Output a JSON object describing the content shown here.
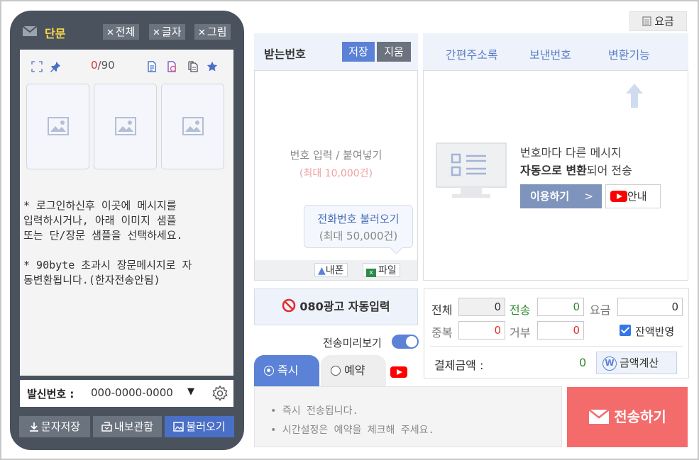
{
  "phone": {
    "msg_type": "단문",
    "clear_buttons": [
      "전체",
      "글자",
      "그림"
    ],
    "byte_current": "0",
    "byte_max": "/90",
    "message_lines": [
      "* 로그인하신후 이곳에 메시지를\n입력하시거나, 아래 이미지 샘플\n또는 단/장문 샘플을 선택하세요.",
      "* 90byte 초과시 장문메시지로 자\n동변환됩니다.(한자전송안됨)"
    ],
    "sender_label": "발신번호 :",
    "sender_number": "000-0000-0000",
    "buttons": {
      "save": "문자저장",
      "sent_box": "내보관함",
      "load": "불러오기"
    }
  },
  "receiver": {
    "title": "받는번호",
    "save_btn": "저장",
    "clear_btn": "지움",
    "hint": "번호 입력 / 붙여넣기",
    "hint_max": "(최대 10,000건)",
    "bubble_title": "전화번호 불러오기",
    "bubble_max": "(최대 50,000건)",
    "my_phone": "내폰",
    "file": "파일"
  },
  "top_right": {
    "fee": "요금"
  },
  "tabs": [
    "간편주소록",
    "보낸번호",
    "변환기능"
  ],
  "info": {
    "line1": "번호마다 다른 메시지",
    "line2_bold": "자동으로 변환",
    "line2_rest": "되어 전송",
    "use_btn": "이용하기",
    "use_btn_chev": ">",
    "guide_btn": "안내"
  },
  "ad080": "080광고 자동입력",
  "preview": "전송미리보기",
  "send_tabs": {
    "now": "즉시",
    "reserve": "예약"
  },
  "notes": [
    "• 즉시 전송됩니다.",
    "• 시간설정은 예약을 체크해 주세요."
  ],
  "stats": {
    "total_label": "전체",
    "total": "0",
    "sent_label": "전송",
    "sent": "0",
    "fee_label": "요금",
    "fee": "0",
    "dup_label": "중복",
    "dup": "0",
    "reject_label": "거부",
    "reject": "0",
    "balance_label": "잔액반영",
    "payment_label": "결제금액 :",
    "payment": "0",
    "calc_btn": "금액계산",
    "calc_icon": "W"
  },
  "send_btn": "전송하기",
  "colors": {
    "phone_bg": "#4a525e",
    "accent_blue": "#5b82d6",
    "send_red": "#f46b6b",
    "msg_type_yellow": "#ffd94a"
  }
}
